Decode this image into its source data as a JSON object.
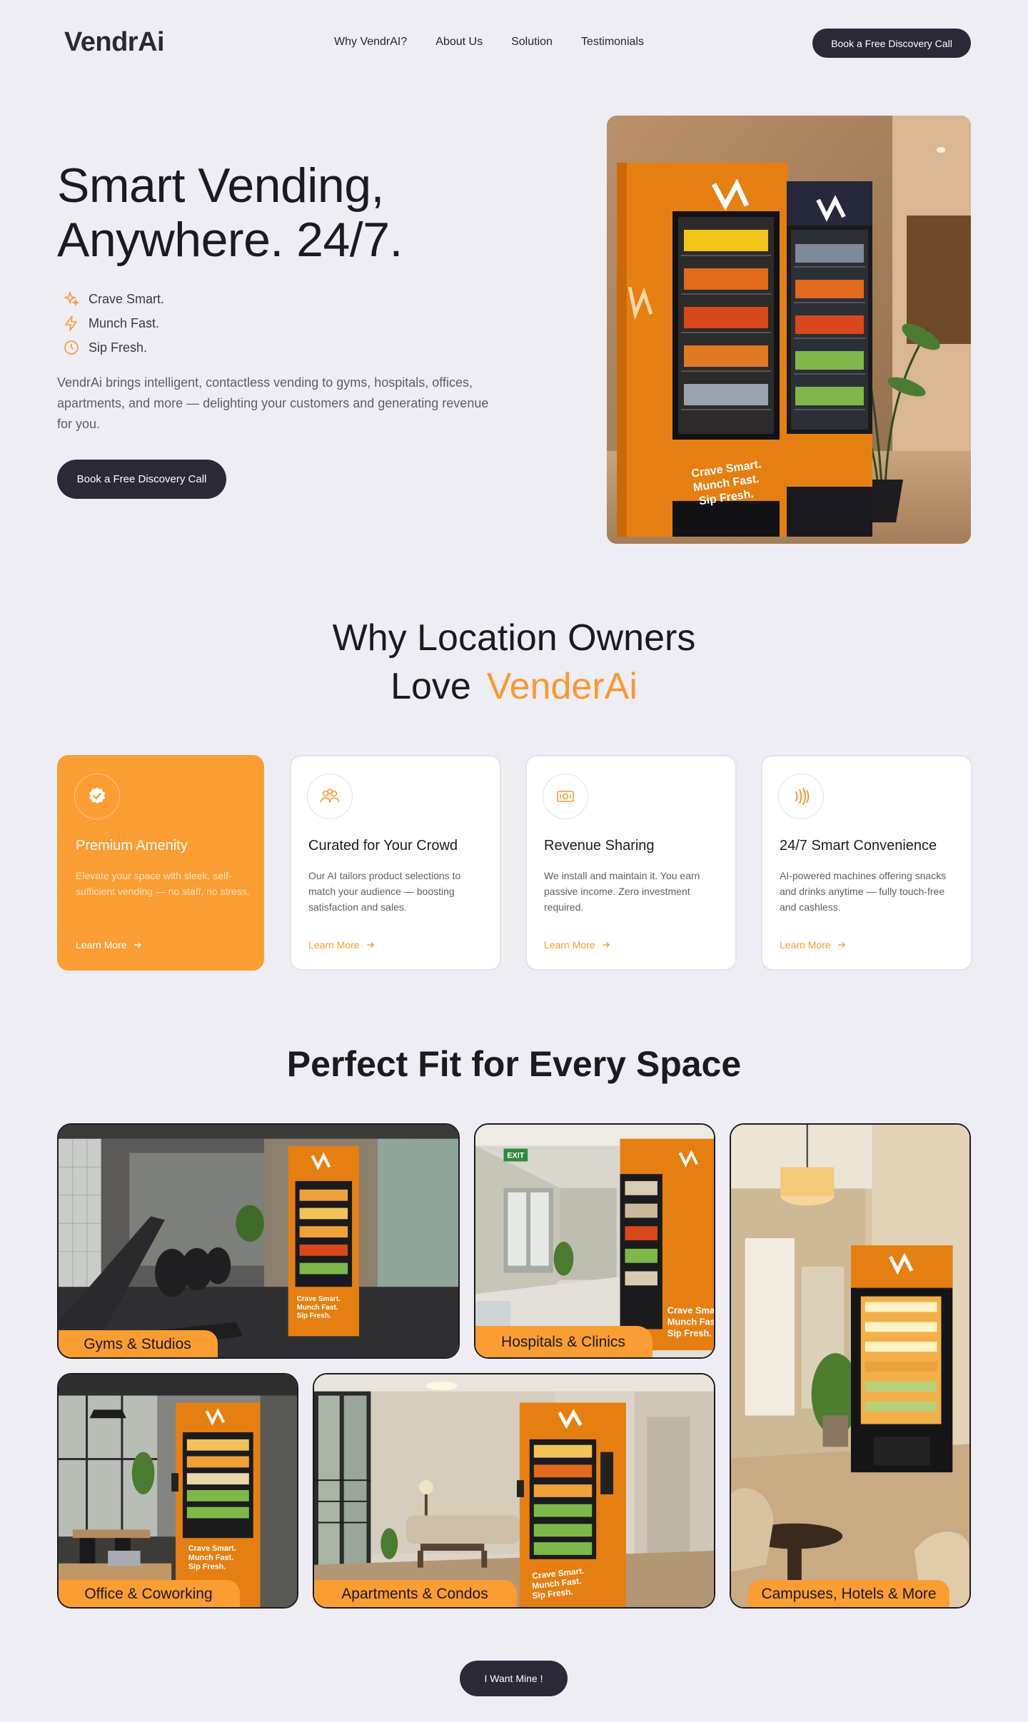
{
  "nav": {
    "logo": "VendrAi",
    "links": [
      "Why VendrAI?",
      "About Us",
      "Solution",
      "Testimonials"
    ],
    "cta": "Book a Free Discovery Call"
  },
  "hero": {
    "title": "Smart Vending, Anywhere. 24/7.",
    "bullets": [
      {
        "icon": "sparkle-icon",
        "text": "Crave Smart."
      },
      {
        "icon": "lightning-icon",
        "text": "Munch Fast."
      },
      {
        "icon": "clock-icon",
        "text": "Sip Fresh."
      }
    ],
    "description": "VendrAi brings intelligent, contactless vending to gyms, hospitals, offices, apartments, and more — delighting your customers and generating revenue for you.",
    "cta": "Book a Free Discovery Call",
    "machine_text": "Crave Smart. Munch Fast. Sip Fresh."
  },
  "why": {
    "title_line1": "Why Location Owners",
    "title_line2": "Love",
    "title_accent": "VenderAi",
    "cards": [
      {
        "icon": "badge-check-icon",
        "title": "Premium Amenity",
        "text": "Elevate your space with sleek, self-sufficient vending — no staff, no stress.",
        "link": "Learn More"
      },
      {
        "icon": "users-icon",
        "title": "Curated for Your Crowd",
        "text": "Our AI tailors product selections to match your audience — boosting satisfaction and sales.",
        "link": "Learn More"
      },
      {
        "icon": "money-icon",
        "title": "Revenue Sharing",
        "text": "We install and maintain it. You earn passive income. Zero investment required.",
        "link": "Learn More"
      },
      {
        "icon": "contactless-icon",
        "title": "24/7 Smart Convenience",
        "text": "AI-powered machines offering snacks and drinks anytime — fully touch-free and cashless.",
        "link": "Learn More"
      }
    ]
  },
  "fit": {
    "title": "Perfect Fit for Every Space",
    "tiles": [
      "Gyms & Studios",
      "Hospitals & Clinics",
      "Campuses, Hotels & More",
      "Office & Coworking",
      "Apartments & Condos"
    ],
    "exit_sign": "EXIT"
  },
  "bottom_cta": "I Want Mine !",
  "colors": {
    "accent": "#fa9d33",
    "dark": "#2b2838",
    "background": "#eeedf4"
  }
}
